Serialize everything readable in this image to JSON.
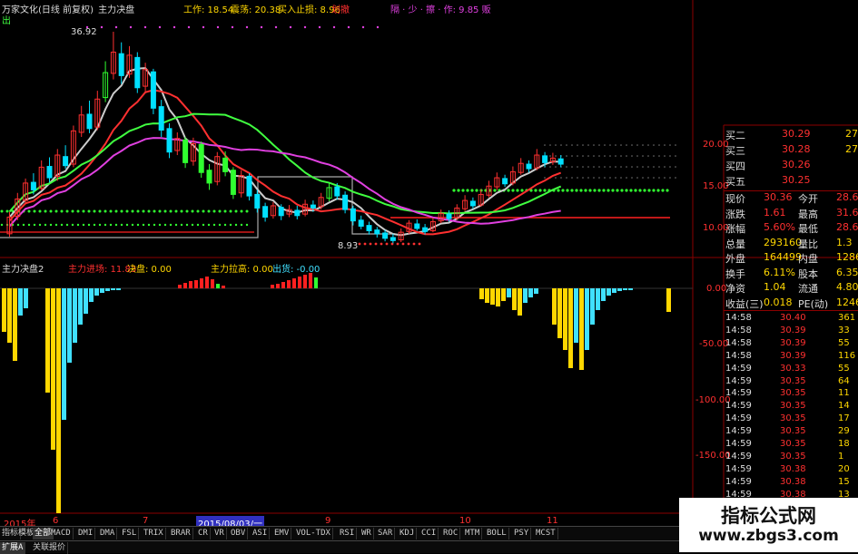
{
  "header": {
    "stock": "万家文化(日线 前复权)",
    "indicator": "主力决盘",
    "work_label": "工作: 18.54",
    "rise_label": "震荡: 20.38",
    "buy_stop_label": "买入止损: 8.96",
    "fall_label": "划撤",
    "signal_label": "隔 · 少 · 擦 · 作: 9.85 贩",
    "out_label": "出",
    "peak_label": "36.92",
    "low_label": "8.93"
  },
  "sub_header": {
    "name": "主力决盘2",
    "main_entry": "主力进场: 11.83",
    "decide": "决盘: 0.00",
    "pull": "主力拉高: 0.00",
    "exit": "出货: -0.00"
  },
  "price_axis": [
    "20.00",
    "15.00",
    "10.00"
  ],
  "sub_axis": [
    "0.00",
    "-50.00",
    "-100.00",
    "-150.00"
  ],
  "x_axis": [
    "2015年",
    "6",
    "7",
    "2015/08/03/一",
    "9",
    "10",
    "11"
  ],
  "quote_top": [
    {
      "label": "买二",
      "value": "30.29",
      "vol": "27"
    },
    {
      "label": "买三",
      "value": "30.28",
      "vol": "27"
    },
    {
      "label": "买四",
      "value": "30.26",
      "vol": ""
    },
    {
      "label": "买五",
      "value": "30.25",
      "vol": ""
    }
  ],
  "quote_stats": [
    {
      "l1": "现价",
      "v1": "30.36",
      "l2": "今开",
      "v2": "28.6"
    },
    {
      "l1": "涨跌",
      "v1": "1.61",
      "l2": "最高",
      "v2": "31.6"
    },
    {
      "l1": "涨幅",
      "v1": "5.60%",
      "l2": "最低",
      "v2": "28.6"
    },
    {
      "l1": "总量",
      "v1": "293160",
      "l2": "量比",
      "v2": "1.3"
    },
    {
      "l1": "外盘",
      "v1": "164499",
      "l2": "内盘",
      "v2": "12866"
    },
    {
      "l1": "换手",
      "v1": "6.11%",
      "l2": "股本",
      "v2": "6.35"
    },
    {
      "l1": "净资",
      "v1": "1.04",
      "l2": "流通",
      "v2": "4.80"
    },
    {
      "l1": "收益(三)",
      "v1": "0.018",
      "l2": "PE(动)",
      "v2": "1246."
    }
  ],
  "ticks": [
    {
      "t": "14:58",
      "p": "30.40",
      "v": "361"
    },
    {
      "t": "14:58",
      "p": "30.39",
      "v": "33"
    },
    {
      "t": "14:58",
      "p": "30.39",
      "v": "55"
    },
    {
      "t": "14:58",
      "p": "30.39",
      "v": "116"
    },
    {
      "t": "14:59",
      "p": "30.33",
      "v": "55"
    },
    {
      "t": "14:59",
      "p": "30.35",
      "v": "64"
    },
    {
      "t": "14:59",
      "p": "30.35",
      "v": "11"
    },
    {
      "t": "14:59",
      "p": "30.35",
      "v": "14"
    },
    {
      "t": "14:59",
      "p": "30.35",
      "v": "17"
    },
    {
      "t": "14:59",
      "p": "30.35",
      "v": "29"
    },
    {
      "t": "14:59",
      "p": "30.35",
      "v": "18"
    },
    {
      "t": "14:59",
      "p": "30.35",
      "v": "1"
    },
    {
      "t": "14:59",
      "p": "30.38",
      "v": "20"
    },
    {
      "t": "14:59",
      "p": "30.38",
      "v": "15"
    },
    {
      "t": "14:59",
      "p": "30.38",
      "v": "13"
    }
  ],
  "tabs": [
    "指标",
    "模板",
    "全部",
    "MACD",
    "DMI",
    "DMA",
    "FSL",
    "TRIX",
    "BRAR",
    "CR",
    "VR",
    "OBV",
    "ASI",
    "EMV",
    "VOL-TDX",
    "RSI",
    "WR",
    "SAR",
    "KDJ",
    "CCI",
    "ROC",
    "MTM",
    "BOLL",
    "PSY",
    "MCST"
  ],
  "bottom": [
    "扩展A",
    "关联报价"
  ],
  "watermark": {
    "title": "指标公式网",
    "url": "www.zbgs3.com"
  },
  "chart_data": {
    "type": "candlestick",
    "candles": [
      {
        "o": 10.2,
        "c": 12.4,
        "h": 13.1,
        "l": 9.8
      },
      {
        "o": 12.5,
        "c": 14.8,
        "h": 15.6,
        "l": 12.0
      },
      {
        "o": 14.6,
        "c": 16.9,
        "h": 17.5,
        "l": 14.1
      },
      {
        "o": 17.0,
        "c": 16.0,
        "h": 18.2,
        "l": 15.4
      },
      {
        "o": 16.2,
        "c": 19.0,
        "h": 19.9,
        "l": 15.9
      },
      {
        "o": 19.1,
        "c": 17.6,
        "h": 20.3,
        "l": 17.0
      },
      {
        "o": 17.8,
        "c": 20.6,
        "h": 21.4,
        "l": 17.2
      },
      {
        "o": 20.4,
        "c": 19.2,
        "h": 21.9,
        "l": 18.8
      },
      {
        "o": 19.4,
        "c": 23.8,
        "h": 24.5,
        "l": 19.0
      },
      {
        "o": 23.6,
        "c": 25.9,
        "h": 27.1,
        "l": 23.0
      },
      {
        "o": 26.0,
        "c": 24.1,
        "h": 27.8,
        "l": 23.5
      },
      {
        "o": 24.3,
        "c": 28.0,
        "h": 29.1,
        "l": 23.9
      },
      {
        "o": 28.2,
        "c": 31.5,
        "h": 33.0,
        "l": 27.6
      },
      {
        "o": 31.4,
        "c": 34.2,
        "h": 36.9,
        "l": 30.6
      },
      {
        "o": 34.0,
        "c": 31.1,
        "h": 35.5,
        "l": 30.0
      },
      {
        "o": 31.3,
        "c": 33.8,
        "h": 35.0,
        "l": 30.8
      },
      {
        "o": 33.5,
        "c": 29.5,
        "h": 34.2,
        "l": 28.8
      },
      {
        "o": 29.7,
        "c": 31.9,
        "h": 32.8,
        "l": 29.0
      },
      {
        "o": 31.6,
        "c": 26.8,
        "h": 32.0,
        "l": 26.0
      },
      {
        "o": 27.0,
        "c": 23.9,
        "h": 27.9,
        "l": 23.0
      },
      {
        "o": 24.1,
        "c": 21.0,
        "h": 24.8,
        "l": 20.2
      },
      {
        "o": 21.2,
        "c": 22.8,
        "h": 23.6,
        "l": 20.6
      },
      {
        "o": 22.6,
        "c": 19.6,
        "h": 23.0,
        "l": 18.9
      },
      {
        "o": 19.8,
        "c": 22.1,
        "h": 22.9,
        "l": 19.2
      },
      {
        "o": 22.0,
        "c": 18.3,
        "h": 22.4,
        "l": 17.6
      },
      {
        "o": 18.6,
        "c": 16.9,
        "h": 19.4,
        "l": 16.0
      },
      {
        "o": 17.1,
        "c": 20.4,
        "h": 21.0,
        "l": 16.6
      },
      {
        "o": 20.2,
        "c": 18.4,
        "h": 21.1,
        "l": 17.8
      },
      {
        "o": 18.6,
        "c": 15.4,
        "h": 19.0,
        "l": 14.8
      },
      {
        "o": 15.6,
        "c": 17.9,
        "h": 18.6,
        "l": 15.0
      },
      {
        "o": 17.8,
        "c": 15.2,
        "h": 18.2,
        "l": 14.6
      },
      {
        "o": 15.4,
        "c": 13.6,
        "h": 16.0,
        "l": 13.0
      },
      {
        "o": 13.8,
        "c": 12.4,
        "h": 14.3,
        "l": 11.8
      },
      {
        "o": 12.6,
        "c": 13.9,
        "h": 14.4,
        "l": 12.2
      },
      {
        "o": 13.7,
        "c": 12.6,
        "h": 14.1,
        "l": 12.0
      },
      {
        "o": 12.8,
        "c": 13.4,
        "h": 14.0,
        "l": 12.4
      },
      {
        "o": 13.3,
        "c": 12.6,
        "h": 13.9,
        "l": 12.1
      },
      {
        "o": 12.8,
        "c": 14.1,
        "h": 14.7,
        "l": 12.5
      },
      {
        "o": 14.0,
        "c": 13.6,
        "h": 14.6,
        "l": 13.1
      },
      {
        "o": 13.8,
        "c": 15.0,
        "h": 15.6,
        "l": 13.4
      },
      {
        "o": 14.9,
        "c": 16.3,
        "h": 16.9,
        "l": 14.5
      },
      {
        "o": 16.4,
        "c": 15.2,
        "h": 16.9,
        "l": 14.7
      },
      {
        "o": 15.3,
        "c": 13.4,
        "h": 15.8,
        "l": 12.9
      },
      {
        "o": 13.5,
        "c": 11.9,
        "h": 13.9,
        "l": 11.3
      },
      {
        "o": 12.0,
        "c": 11.2,
        "h": 12.6,
        "l": 10.8
      },
      {
        "o": 11.3,
        "c": 10.6,
        "h": 11.8,
        "l": 10.1
      },
      {
        "o": 10.7,
        "c": 10.2,
        "h": 11.1,
        "l": 9.7
      },
      {
        "o": 10.3,
        "c": 9.6,
        "h": 10.7,
        "l": 9.2
      },
      {
        "o": 9.7,
        "c": 9.3,
        "h": 10.2,
        "l": 8.93
      },
      {
        "o": 9.4,
        "c": 10.4,
        "h": 10.9,
        "l": 9.1
      },
      {
        "o": 10.5,
        "c": 11.6,
        "h": 12.0,
        "l": 10.2
      },
      {
        "o": 11.5,
        "c": 10.9,
        "h": 12.1,
        "l": 10.6
      },
      {
        "o": 11.0,
        "c": 10.5,
        "h": 11.5,
        "l": 10.1
      },
      {
        "o": 10.6,
        "c": 11.8,
        "h": 12.3,
        "l": 10.4
      },
      {
        "o": 11.9,
        "c": 12.9,
        "h": 13.4,
        "l": 11.6
      },
      {
        "o": 12.8,
        "c": 12.2,
        "h": 13.3,
        "l": 11.8
      },
      {
        "o": 12.3,
        "c": 13.6,
        "h": 14.1,
        "l": 12.0
      },
      {
        "o": 13.5,
        "c": 14.6,
        "h": 15.3,
        "l": 13.2
      },
      {
        "o": 14.5,
        "c": 13.9,
        "h": 15.0,
        "l": 13.5
      },
      {
        "o": 14.0,
        "c": 15.4,
        "h": 16.1,
        "l": 13.8
      },
      {
        "o": 15.3,
        "c": 16.5,
        "h": 17.2,
        "l": 15.0
      },
      {
        "o": 16.4,
        "c": 17.6,
        "h": 18.3,
        "l": 16.0
      },
      {
        "o": 17.5,
        "c": 16.8,
        "h": 18.0,
        "l": 16.4
      },
      {
        "o": 16.9,
        "c": 18.4,
        "h": 19.1,
        "l": 16.6
      },
      {
        "o": 18.3,
        "c": 19.5,
        "h": 20.2,
        "l": 18.0
      },
      {
        "o": 19.4,
        "c": 18.8,
        "h": 19.9,
        "l": 18.3
      },
      {
        "o": 18.9,
        "c": 20.6,
        "h": 21.4,
        "l": 18.6
      },
      {
        "o": 20.5,
        "c": 19.6,
        "h": 21.0,
        "l": 19.0
      },
      {
        "o": 19.7,
        "c": 20.2,
        "h": 20.9,
        "l": 19.3
      },
      {
        "o": 20.1,
        "c": 19.4,
        "h": 20.6,
        "l": 19.0
      }
    ]
  }
}
